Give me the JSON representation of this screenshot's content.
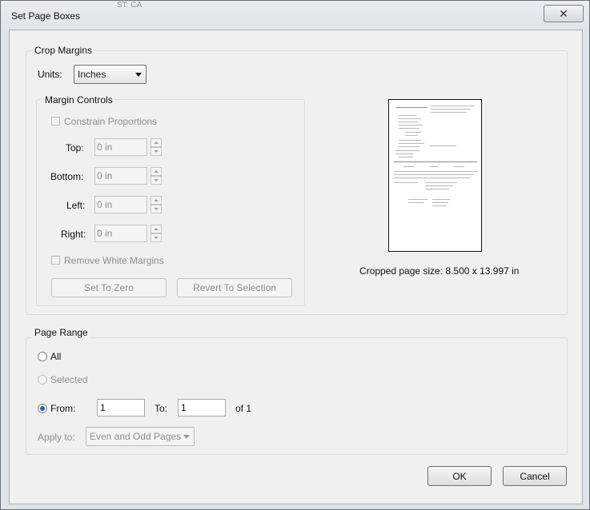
{
  "window": {
    "title": "Set Page Boxes",
    "background_ghost_text": "ST: CA",
    "close_glyph": "✕"
  },
  "crop_margins": {
    "group_label": "Crop Margins",
    "units_label": "Units:",
    "units_value": "Inches",
    "margin_controls": {
      "group_label": "Margin Controls",
      "constrain_proportions": "Constrain Proportions",
      "top_label": "Top:",
      "top_value": "0 in",
      "bottom_label": "Bottom:",
      "bottom_value": "0 in",
      "left_label": "Left:",
      "left_value": "0 in",
      "right_label": "Right:",
      "right_value": "0 in",
      "remove_white_margins": "Remove White Margins",
      "set_to_zero": "Set To Zero",
      "revert_to_selection": "Revert To Selection"
    },
    "cropped_page_size": "Cropped page size: 8.500 x 13.997 in"
  },
  "page_range": {
    "group_label": "Page Range",
    "all_label": "All",
    "selected_label": "Selected",
    "from_label": "From:",
    "from_value": "1",
    "to_label": "To:",
    "to_value": "1",
    "of_label": "of 1",
    "apply_to_label": "Apply to:",
    "apply_to_value": "Even and Odd Pages",
    "selected_option": "From"
  },
  "buttons": {
    "ok": "OK",
    "cancel": "Cancel"
  }
}
